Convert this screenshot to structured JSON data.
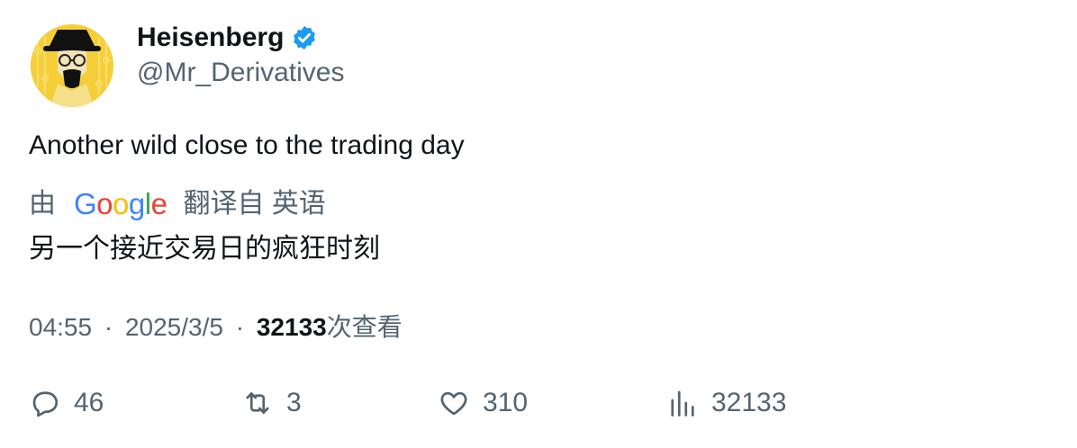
{
  "user": {
    "display_name": "Heisenberg",
    "handle": "@Mr_Derivatives",
    "verified": true,
    "verified_color": "#1d9bf0",
    "avatar_bg": "#f5cf3a"
  },
  "tweet": {
    "text": "Another wild close to the trading day",
    "translation": {
      "prefix": "由",
      "provider_logo": [
        "G",
        "o",
        "o",
        "g",
        "l",
        "e"
      ],
      "provider_colors": [
        "#4285f4",
        "#ea4335",
        "#fbbc05",
        "#4285f4",
        "#34a853",
        "#ea4335"
      ],
      "suffix": "翻译自 英语",
      "text": "另一个接近交易日的疯狂时刻"
    },
    "meta": {
      "time": "04:55",
      "date": "2025/3/5",
      "separator": "·",
      "views": "32133",
      "views_label": "次查看"
    }
  },
  "actions": {
    "reply": {
      "icon": "reply-icon",
      "count": "46"
    },
    "retweet": {
      "icon": "retweet-icon",
      "count": "3"
    },
    "like": {
      "icon": "heart-icon",
      "count": "310"
    },
    "views": {
      "icon": "analytics-icon",
      "count": "32133"
    }
  }
}
